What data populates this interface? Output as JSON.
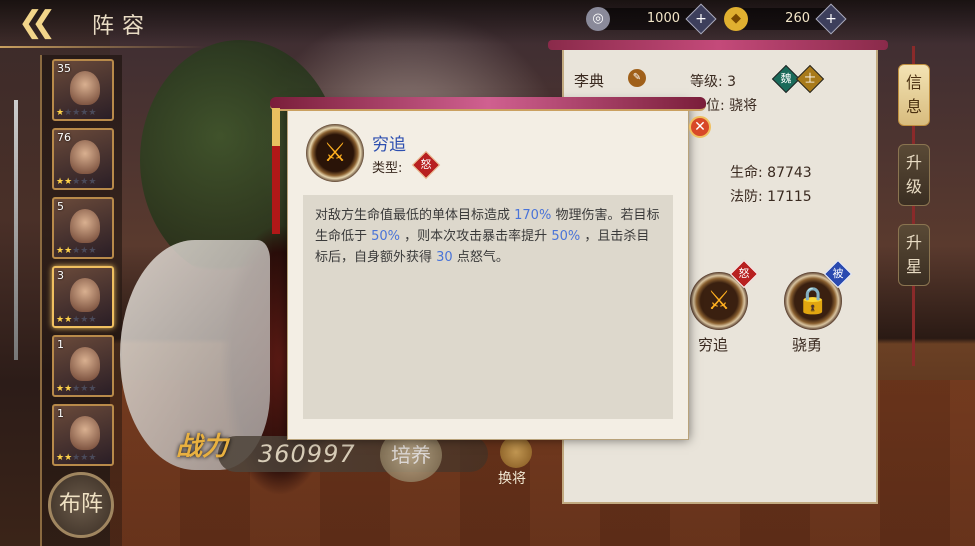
{
  "header": {
    "title": "阵容",
    "back_icon": "double-chevron-left-icon"
  },
  "resources": [
    {
      "icon": "silver-coin-icon",
      "value": "1000"
    },
    {
      "icon": "gold-ingot-icon",
      "value": "260"
    }
  ],
  "heroes": [
    {
      "level": "35",
      "stars": 1
    },
    {
      "level": "76",
      "stars": 2
    },
    {
      "level": "5",
      "stars": 2
    },
    {
      "level": "3",
      "stars": 2,
      "selected": true
    },
    {
      "level": "1",
      "stars": 2
    },
    {
      "level": "1",
      "stars": 2
    }
  ],
  "formation_label": "布阵",
  "power": {
    "label": "战力",
    "value": "360997"
  },
  "cultivate_label": "培养",
  "swap_label": "换将",
  "info": {
    "name": "李典",
    "level": "等级: 3",
    "badges": [
      {
        "text": "魏",
        "color": "#1a6a5a"
      },
      {
        "text": "士",
        "color": "#a87a1a"
      }
    ],
    "position": "位: 骁将",
    "hp": "生命: 87743",
    "mdef": "法防: 17115",
    "skills": [
      {
        "name": "穷追",
        "tag": "怒",
        "tag_color": "#b82020",
        "glyph": "⚔"
      },
      {
        "name": "骁勇",
        "tag": "被",
        "tag_color": "#2a4ab0",
        "glyph": "🔒"
      }
    ]
  },
  "side_tabs": [
    "信息",
    "升级",
    "升星"
  ],
  "popup": {
    "title": "穷追",
    "type_label": "类型:",
    "type_tag": "怒",
    "desc": [
      {
        "t": "对敌方生命值最低的单体目标造成 "
      },
      {
        "t": "170%",
        "hl": true
      },
      {
        "t": " 物理伤害。若目标生命低于 "
      },
      {
        "t": "50%",
        "hl": true
      },
      {
        "t": " ，则本次攻击暴击率提升 "
      },
      {
        "t": "50%",
        "hl": true
      },
      {
        "t": " ，且击杀目标后，自身额外获得 "
      },
      {
        "t": "30",
        "hl": true
      },
      {
        "t": " 点怒气。"
      }
    ]
  },
  "colors": {
    "highlight": "#4a74d8",
    "title_blue": "#2d4fb0",
    "rage_red": "#b82020"
  }
}
